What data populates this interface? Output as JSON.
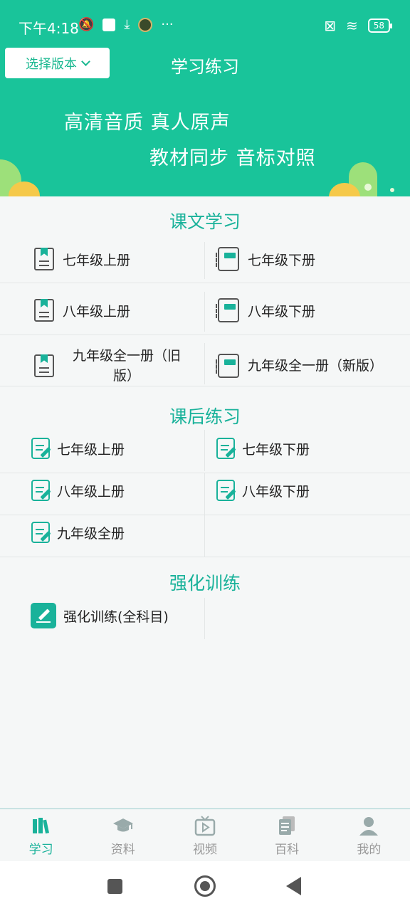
{
  "status_bar": {
    "time": "下午4:18",
    "more": "···",
    "battery": "58"
  },
  "header": {
    "version_button": "选择版本",
    "title": "学习练习",
    "slogan_line1": "高清音质 真人原声",
    "slogan_line2": "教材同步 音标对照"
  },
  "lesson_study": {
    "title": "课文学习",
    "items": [
      "七年级上册",
      "七年级下册",
      "八年级上册",
      "八年级下册",
      "九年级全一册（旧版）",
      "九年级全一册（新版）"
    ]
  },
  "after_class": {
    "title": "课后练习",
    "items": [
      "七年级上册",
      "七年级下册",
      "八年级上册",
      "八年级下册",
      "九年级全册"
    ]
  },
  "intensive": {
    "title": "强化训练",
    "items": [
      "强化训练(全科目)"
    ]
  },
  "bottom_nav": {
    "items": [
      {
        "label": "学习",
        "icon": "books-icon",
        "active": true
      },
      {
        "label": "资料",
        "icon": "graduation-cap-icon",
        "active": false
      },
      {
        "label": "视频",
        "icon": "tv-play-icon",
        "active": false
      },
      {
        "label": "百科",
        "icon": "documents-icon",
        "active": false
      },
      {
        "label": "我的",
        "icon": "user-icon",
        "active": false
      }
    ]
  },
  "colors": {
    "accent": "#19c49a",
    "section_title": "#19b29a"
  }
}
